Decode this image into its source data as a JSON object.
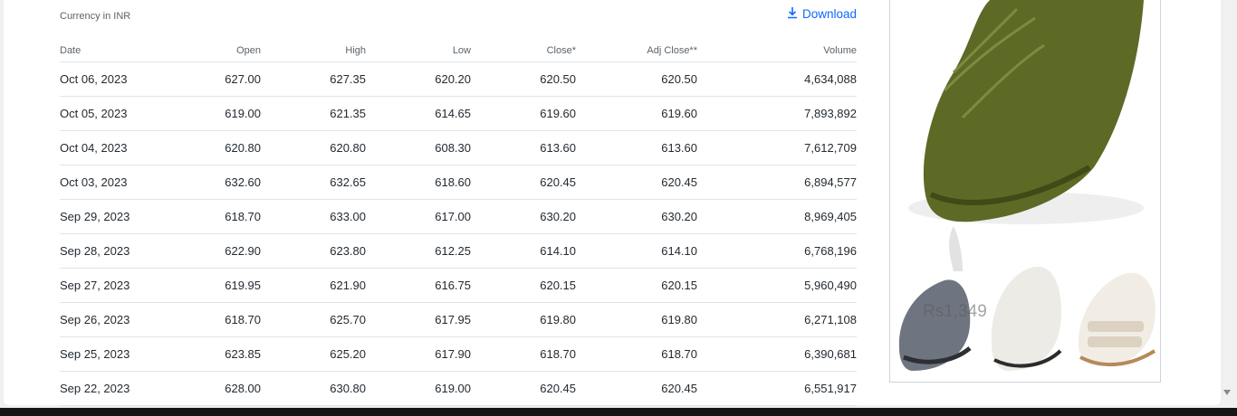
{
  "currency_label": "Currency in INR",
  "download_label": "Download",
  "columns": [
    "Date",
    "Open",
    "High",
    "Low",
    "Close*",
    "Adj Close**",
    "Volume"
  ],
  "rows": [
    [
      "Oct 06, 2023",
      "627.00",
      "627.35",
      "620.20",
      "620.50",
      "620.50",
      "4,634,088"
    ],
    [
      "Oct 05, 2023",
      "619.00",
      "621.35",
      "614.65",
      "619.60",
      "619.60",
      "7,893,892"
    ],
    [
      "Oct 04, 2023",
      "620.80",
      "620.80",
      "608.30",
      "613.60",
      "613.60",
      "7,612,709"
    ],
    [
      "Oct 03, 2023",
      "632.60",
      "632.65",
      "618.60",
      "620.45",
      "620.45",
      "6,894,577"
    ],
    [
      "Sep 29, 2023",
      "618.70",
      "633.00",
      "617.00",
      "630.20",
      "630.20",
      "8,969,405"
    ],
    [
      "Sep 28, 2023",
      "622.90",
      "623.80",
      "612.25",
      "614.10",
      "614.10",
      "6,768,196"
    ],
    [
      "Sep 27, 2023",
      "619.95",
      "621.90",
      "616.75",
      "620.15",
      "620.15",
      "5,960,490"
    ],
    [
      "Sep 26, 2023",
      "618.70",
      "625.70",
      "617.95",
      "619.80",
      "619.80",
      "6,271,108"
    ],
    [
      "Sep 25, 2023",
      "623.85",
      "625.20",
      "617.90",
      "618.70",
      "618.70",
      "6,390,681"
    ],
    [
      "Sep 22, 2023",
      "628.00",
      "630.80",
      "619.00",
      "620.45",
      "620.45",
      "6,551,917"
    ]
  ],
  "ad": {
    "price": "Rs1,349",
    "colors": {
      "shoe_main": "#5c6a26",
      "shoe_grey": "#6f7580",
      "shoe_white": "#ecebe5",
      "sandal": "#f2ede4"
    }
  },
  "colors": {
    "accent": "#0f69ff",
    "text": "#232a31",
    "muted": "#5b636a",
    "divider": "#e0e4e9"
  }
}
